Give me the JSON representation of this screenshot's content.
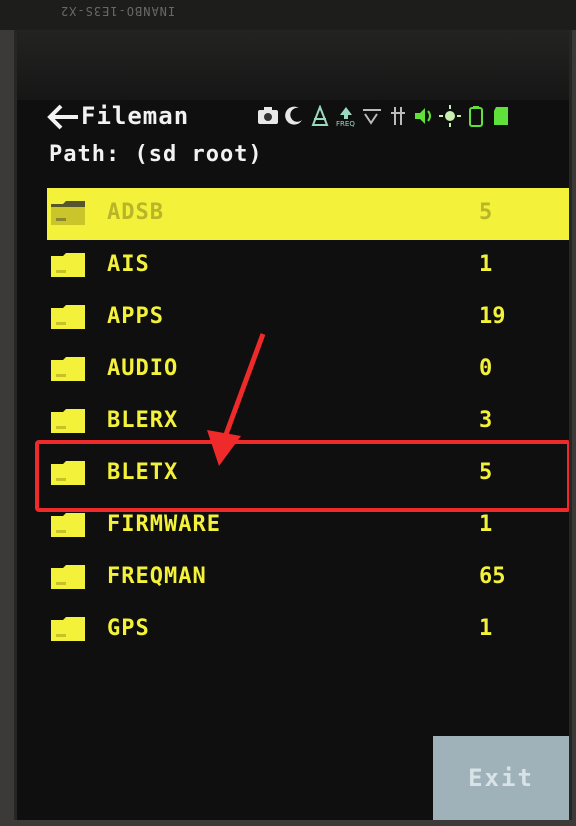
{
  "device_label": "INANBO-1E3S-X2",
  "header": {
    "title": "Fileman",
    "path": "Path: (sd root)"
  },
  "status_icons": [
    "camera-icon",
    "moon-icon",
    "tower-icon",
    "freq-icon",
    "stealth-icon",
    "antenna-icon",
    "speaker-icon",
    "sun-icon",
    "battery-icon",
    "sdcard-icon"
  ],
  "files": [
    {
      "name": "ADSB",
      "count": "5"
    },
    {
      "name": "AIS",
      "count": "1"
    },
    {
      "name": "APPS",
      "count": "19"
    },
    {
      "name": "AUDIO",
      "count": "0"
    },
    {
      "name": "BLERX",
      "count": "3"
    },
    {
      "name": "BLETX",
      "count": "5"
    },
    {
      "name": "FIRMWARE",
      "count": "1"
    },
    {
      "name": "FREQMAN",
      "count": "65"
    },
    {
      "name": "GPS",
      "count": "1"
    }
  ],
  "exit_label": "Exit",
  "colors": {
    "text_yellow": "#f3f13a",
    "highlight_red": "#ee2a2a",
    "exit_button": "#9fb2ba"
  }
}
